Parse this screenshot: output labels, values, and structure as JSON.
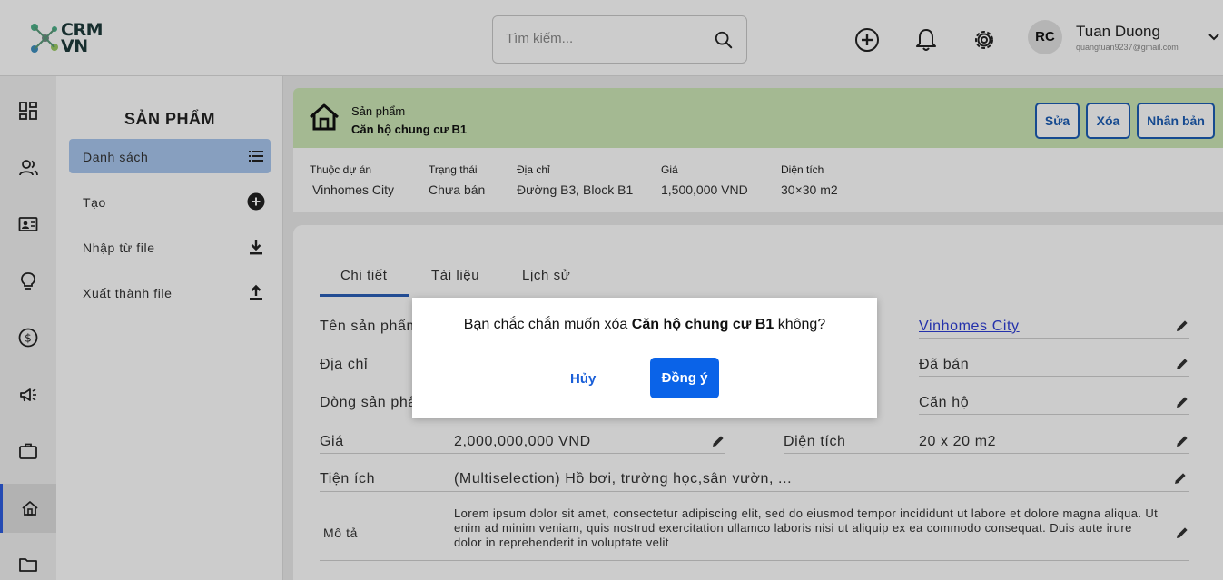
{
  "header": {
    "logo_line1": "CRM",
    "logo_line2": "VN",
    "search_placeholder": "Tìm kiếm...",
    "user": {
      "initials": "RC",
      "name": "Tuan Duong",
      "email": "quangtuan9237@gmail.com"
    }
  },
  "sidebar": {
    "title": "SẢN PHẨM",
    "items": [
      {
        "label": "Danh sách",
        "icon": "list-icon"
      },
      {
        "label": "Tạo",
        "icon": "plus-circle-icon"
      },
      {
        "label": "Nhập từ file",
        "icon": "download-icon"
      },
      {
        "label": "Xuất thành file",
        "icon": "upload-icon"
      }
    ]
  },
  "rail": [
    "dashboard-icon",
    "users-icon",
    "contact-card-icon",
    "lightbulb-icon",
    "dollar-icon",
    "megaphone-icon",
    "briefcase-icon",
    "home-icon",
    "folder-icon"
  ],
  "banner": {
    "subtitle": "Sản phẩm",
    "title": "Căn hộ chung cư B1",
    "buttons": {
      "edit": "Sửa",
      "delete": "Xóa",
      "clone": "Nhân bản"
    }
  },
  "summary": [
    {
      "label": "Thuộc dự án",
      "value": "Vinhomes City"
    },
    {
      "label": "Trạng thái",
      "value": "Chưa bán"
    },
    {
      "label": "Địa chỉ",
      "value": "Đường B3, Block B1"
    },
    {
      "label": "Giá",
      "value": "1,500,000 VND"
    },
    {
      "label": "Diện tích",
      "value": "30×30 m2"
    }
  ],
  "tabs": [
    "Chi tiết",
    "Tài liệu",
    "Lịch sử"
  ],
  "fields": {
    "name_label": "Tên sản phẩm",
    "address_label": "Địa chỉ",
    "line_label": "Dòng sản phẩm",
    "project_value": "Vinhomes City",
    "status_value": "Đã bán",
    "type_value": "Căn hộ",
    "price_label": "Giá",
    "price_value": "2,000,000,000 VND",
    "area_label": "Diện tích",
    "area_value": "20 x 20 m2",
    "amenities_label": "Tiện ích",
    "amenities_value": "(Multiselection) Hồ bơi, trường học,sân vườn, ...",
    "desc_label": "Mô tả",
    "desc_value": "Lorem ipsum dolor sit amet, consectetur adipiscing elit, sed do eiusmod tempor incididunt ut labore et dolore magna aliqua. Ut enim ad minim veniam, quis nostrud exercitation ullamco laboris nisi ut aliquip ex ea commodo consequat. Duis aute irure dolor in reprehenderit in voluptate velit"
  },
  "dialog": {
    "message_prefix": "Bạn chắc chắn muốn xóa",
    "message_item": "Căn hộ chung cư B1",
    "message_suffix": "không?",
    "cancel": "Hủy",
    "confirm": "Đồng ý"
  },
  "colors": {
    "accent": "#1c5db5",
    "banner": "#cde8b7",
    "active_menu": "#a9c7ef",
    "confirm_button": "#0a63e8"
  }
}
